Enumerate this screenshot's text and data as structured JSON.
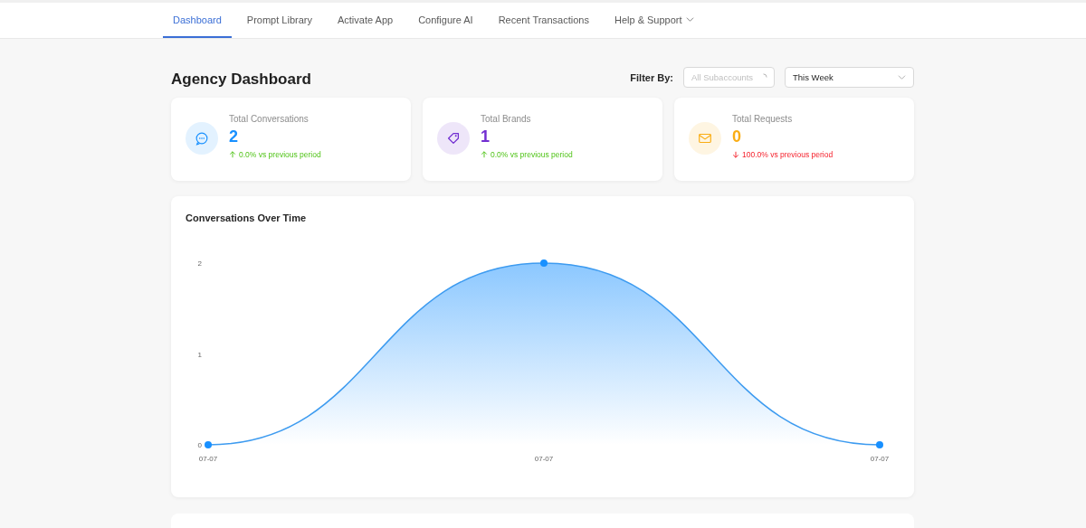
{
  "nav": {
    "tabs": [
      {
        "label": "Dashboard",
        "selected": true
      },
      {
        "label": "Prompt Library",
        "selected": false
      },
      {
        "label": "Activate App",
        "selected": false
      },
      {
        "label": "Configure AI",
        "selected": false
      },
      {
        "label": "Recent Transactions",
        "selected": false
      },
      {
        "label": "Help & Support",
        "selected": false,
        "dropdown": true
      }
    ]
  },
  "page": {
    "title": "Agency Dashboard",
    "filter_label": "Filter By:",
    "subaccount_select": {
      "placeholder": "All Subaccounts",
      "loading": true
    },
    "period_select": {
      "value": "This Week"
    }
  },
  "stats": [
    {
      "kind": "conversations",
      "label": "Total Conversations",
      "value": "2",
      "color": "#1890ff",
      "increase": true,
      "change": "0.0% vs previous period"
    },
    {
      "kind": "brands",
      "label": "Total Brands",
      "value": "1",
      "color": "#722ed1",
      "increase": true,
      "change": "0.0% vs previous period"
    },
    {
      "kind": "requests",
      "label": "Total Requests",
      "value": "0",
      "color": "#faad14",
      "increase": false,
      "change": "100.0% vs previous period"
    }
  ],
  "chart": {
    "title": "Conversations Over Time",
    "chart_data": {
      "type": "area",
      "categories": [
        "07-07",
        "07-07",
        "07-07"
      ],
      "values": [
        0,
        2,
        0
      ],
      "ylim": [
        0,
        2
      ],
      "yticks": [
        0,
        1,
        2
      ]
    }
  }
}
